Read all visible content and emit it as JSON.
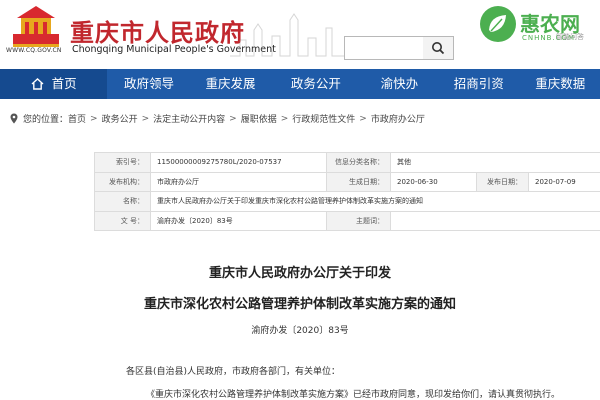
{
  "header": {
    "emblem_url": "WWW.CQ.GOV.CN",
    "title": "重庆市人民政府",
    "subtitle": "Chongqing Municipal People's Government",
    "search_placeholder": "",
    "watermark_name": "惠农网",
    "watermark_domain": "CNHNB.COM",
    "extra_link": "智能问答"
  },
  "nav": {
    "home": "首页",
    "items": [
      "政府领导",
      "重庆发展",
      "政务公开",
      "渝快办",
      "招商引资",
      "重庆数据"
    ]
  },
  "breadcrumb": {
    "prefix": "您的位置：",
    "items": [
      "首页",
      "政务公开",
      "法定主动公开内容",
      "履职依据",
      "行政规范性文件",
      "市政府办公厅"
    ]
  },
  "info": {
    "index_label": "索引号：",
    "index_value": "11500000009275780L/2020-07537",
    "category_label": "信息分类名称：",
    "category_value": "其他",
    "org_label": "发布机构：",
    "org_value": "市政府办公厅",
    "created_label": "生成日期：",
    "created_value": "2020-06-30",
    "published_label": "发布日期：",
    "published_value": "2020-07-09",
    "name_label": "名称：",
    "name_value": "重庆市人民政府办公厅关于印发重庆市深化农村公路管理养护体制改革实施方案的通知",
    "docno_label": "文 号：",
    "docno_value": "渝府办发〔2020〕83号",
    "keywords_label": "主题词：",
    "keywords_value": ""
  },
  "document": {
    "title_line1": "重庆市人民政府办公厅关于印发",
    "title_line2": "重庆市深化农村公路管理养护体制改革实施方案的通知",
    "doc_number": "渝府办发〔2020〕83号",
    "para1": "各区县(自治县)人民政府，市政府各部门，有关单位：",
    "para2": "《重庆市深化农村公路管理养护体制改革实施方案》已经市政府同意，现印发给你们，请认真贯彻执行。"
  },
  "colors": {
    "nav_bg": "#1f5ba8",
    "nav_home_bg": "#154a8f",
    "title_red": "#c1272d",
    "watermark_green": "#4caf50"
  }
}
